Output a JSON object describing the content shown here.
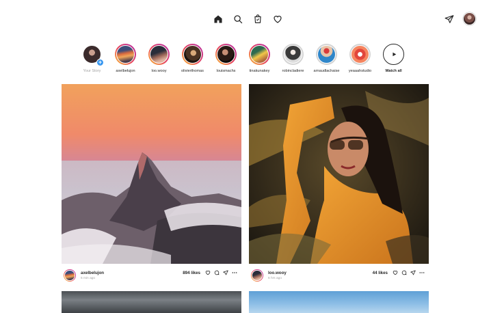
{
  "nav": {
    "icons": [
      "home-icon",
      "search-icon",
      "shop-icon",
      "heart-icon"
    ],
    "right_icons": [
      "direct-message-icon"
    ]
  },
  "stories": [
    {
      "name": "Your Story",
      "style": "muted",
      "ring": "none",
      "avatar": "av1",
      "add_badge": "+"
    },
    {
      "name": "axelbelujon",
      "ring": "active",
      "avatar": "av2"
    },
    {
      "name": "loo.wooy",
      "ring": "active",
      "avatar": "av3"
    },
    {
      "name": "olivierthomas",
      "ring": "active",
      "avatar": "av4"
    },
    {
      "name": "louismachs",
      "ring": "active",
      "avatar": "av5"
    },
    {
      "name": "tinakunakey",
      "ring": "active",
      "avatar": "av6"
    },
    {
      "name": "robincladiere",
      "ring": "seen",
      "avatar": "av7"
    },
    {
      "name": "arnaudlachaise",
      "ring": "seen",
      "avatar": "av8"
    },
    {
      "name": "yeaaahstudio",
      "ring": "seen",
      "avatar": "av9"
    }
  ],
  "watch_all": {
    "label": "Watch all"
  },
  "posts": [
    {
      "username": "axelbelujon",
      "time": "5 min ago",
      "likes": "894 likes",
      "image": "mountain-at-sunset"
    },
    {
      "username": "loo.wooy",
      "time": "6 hrs ago",
      "likes": "44 likes",
      "image": "woman-in-sunglasses-yellow-sweater"
    }
  ],
  "colors": {
    "accent_blue": "#3897f0",
    "story_gradient": [
      "#f9c232",
      "#e8485c",
      "#b129a7"
    ],
    "text": "#262626",
    "muted": "#a3a3a3"
  }
}
